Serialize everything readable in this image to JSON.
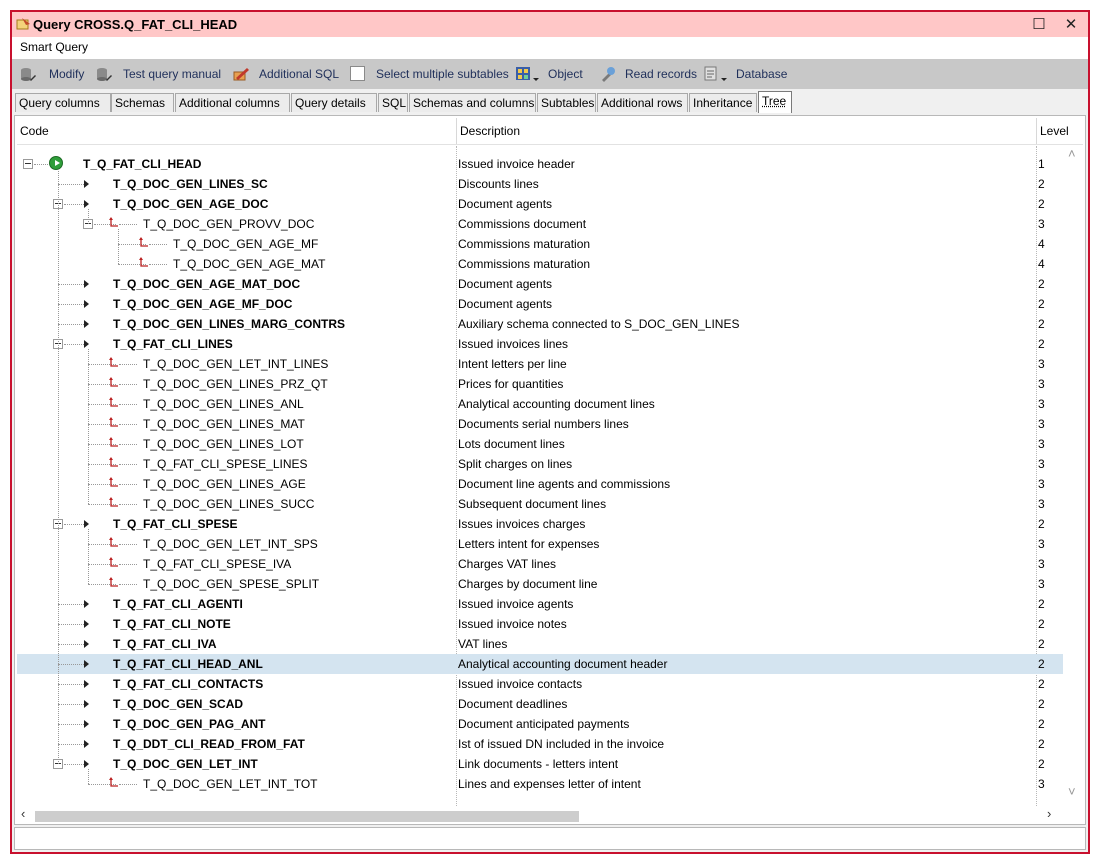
{
  "window": {
    "title": "Query CROSS.Q_FAT_CLI_HEAD",
    "maximize_glyph": "☐",
    "close_glyph": "✕"
  },
  "menu": {
    "item": "Smart Query"
  },
  "toolbar": {
    "modify": "Modify",
    "test_query": "Test query manual",
    "additional_sql": "Additional SQL",
    "select_multiple": "Select multiple subtables",
    "object": "Object",
    "read_records": "Read records",
    "database": "Database"
  },
  "tabs": [
    "Query columns",
    "Schemas",
    "Additional columns",
    "Query details",
    "SQL",
    "Schemas and columns",
    "Subtables",
    "Additional rows",
    "Inheritance",
    "Tree"
  ],
  "tree": {
    "headers": {
      "code": "Code",
      "description": "Description",
      "level": "Level"
    },
    "rows": [
      {
        "code": "T_Q_FAT_CLI_HEAD",
        "desc": "Issued invoice header",
        "level": "1"
      },
      {
        "code": "T_Q_DOC_GEN_LINES_SC",
        "desc": "Discounts lines",
        "level": "2"
      },
      {
        "code": "T_Q_DOC_GEN_AGE_DOC",
        "desc": "Document agents",
        "level": "2"
      },
      {
        "code": "T_Q_DOC_GEN_PROVV_DOC",
        "desc": "Commissions document",
        "level": "3"
      },
      {
        "code": "T_Q_DOC_GEN_AGE_MF",
        "desc": "Commissions maturation",
        "level": "4"
      },
      {
        "code": "T_Q_DOC_GEN_AGE_MAT",
        "desc": "Commissions maturation",
        "level": "4"
      },
      {
        "code": "T_Q_DOC_GEN_AGE_MAT_DOC",
        "desc": "Document agents",
        "level": "2"
      },
      {
        "code": "T_Q_DOC_GEN_AGE_MF_DOC",
        "desc": "Document agents",
        "level": "2"
      },
      {
        "code": "T_Q_DOC_GEN_LINES_MARG_CONTRS",
        "desc": "Auxiliary schema connected to S_DOC_GEN_LINES",
        "level": "2"
      },
      {
        "code": "T_Q_FAT_CLI_LINES",
        "desc": "Issued invoices lines",
        "level": "2"
      },
      {
        "code": "T_Q_DOC_GEN_LET_INT_LINES",
        "desc": "Intent letters per line",
        "level": "3"
      },
      {
        "code": "T_Q_DOC_GEN_LINES_PRZ_QT",
        "desc": "Prices for quantities",
        "level": "3"
      },
      {
        "code": "T_Q_DOC_GEN_LINES_ANL",
        "desc": "Analytical accounting document lines",
        "level": "3"
      },
      {
        "code": "T_Q_DOC_GEN_LINES_MAT",
        "desc": "Documents serial numbers lines",
        "level": "3"
      },
      {
        "code": "T_Q_DOC_GEN_LINES_LOT",
        "desc": "Lots document lines",
        "level": "3"
      },
      {
        "code": "T_Q_FAT_CLI_SPESE_LINES",
        "desc": "Split charges on lines",
        "level": "3"
      },
      {
        "code": "T_Q_DOC_GEN_LINES_AGE",
        "desc": "Document line agents and commissions",
        "level": "3"
      },
      {
        "code": "T_Q_DOC_GEN_LINES_SUCC",
        "desc": "Subsequent document lines",
        "level": "3"
      },
      {
        "code": "T_Q_FAT_CLI_SPESE",
        "desc": "Issues invoices charges",
        "level": "2"
      },
      {
        "code": "T_Q_DOC_GEN_LET_INT_SPS",
        "desc": "Letters intent for expenses",
        "level": "3"
      },
      {
        "code": "T_Q_FAT_CLI_SPESE_IVA",
        "desc": "Charges VAT lines",
        "level": "3"
      },
      {
        "code": "T_Q_DOC_GEN_SPESE_SPLIT",
        "desc": "Charges by document line",
        "level": "3"
      },
      {
        "code": "T_Q_FAT_CLI_AGENTI",
        "desc": "Issued invoice agents",
        "level": "2"
      },
      {
        "code": "T_Q_FAT_CLI_NOTE",
        "desc": "Issued invoice notes",
        "level": "2"
      },
      {
        "code": "T_Q_FAT_CLI_IVA",
        "desc": "VAT lines",
        "level": "2"
      },
      {
        "code": "T_Q_FAT_CLI_HEAD_ANL",
        "desc": "Analytical accounting document header",
        "level": "2"
      },
      {
        "code": "T_Q_FAT_CLI_CONTACTS",
        "desc": "Issued invoice contacts",
        "level": "2"
      },
      {
        "code": "T_Q_DOC_GEN_SCAD",
        "desc": "Document deadlines",
        "level": "2"
      },
      {
        "code": "T_Q_DOC_GEN_PAG_ANT",
        "desc": "Document anticipated payments",
        "level": "2"
      },
      {
        "code": "T_Q_DDT_CLI_READ_FROM_FAT",
        "desc": "Ist of issued DN included in the invoice",
        "level": "2"
      },
      {
        "code": "T_Q_DOC_GEN_LET_INT",
        "desc": "Link documents - letters intent",
        "level": "2"
      },
      {
        "code": "T_Q_DOC_GEN_LET_INT_TOT",
        "desc": "Lines and expenses letter of intent",
        "level": "3"
      }
    ]
  },
  "colors": {
    "window_border": "#c8102e",
    "title_bg": "#ffc7c7",
    "toolbar_bg": "#c8c8c8",
    "selected_row": "#d4e4f0",
    "toolbar_text": "#1f2f5a"
  }
}
